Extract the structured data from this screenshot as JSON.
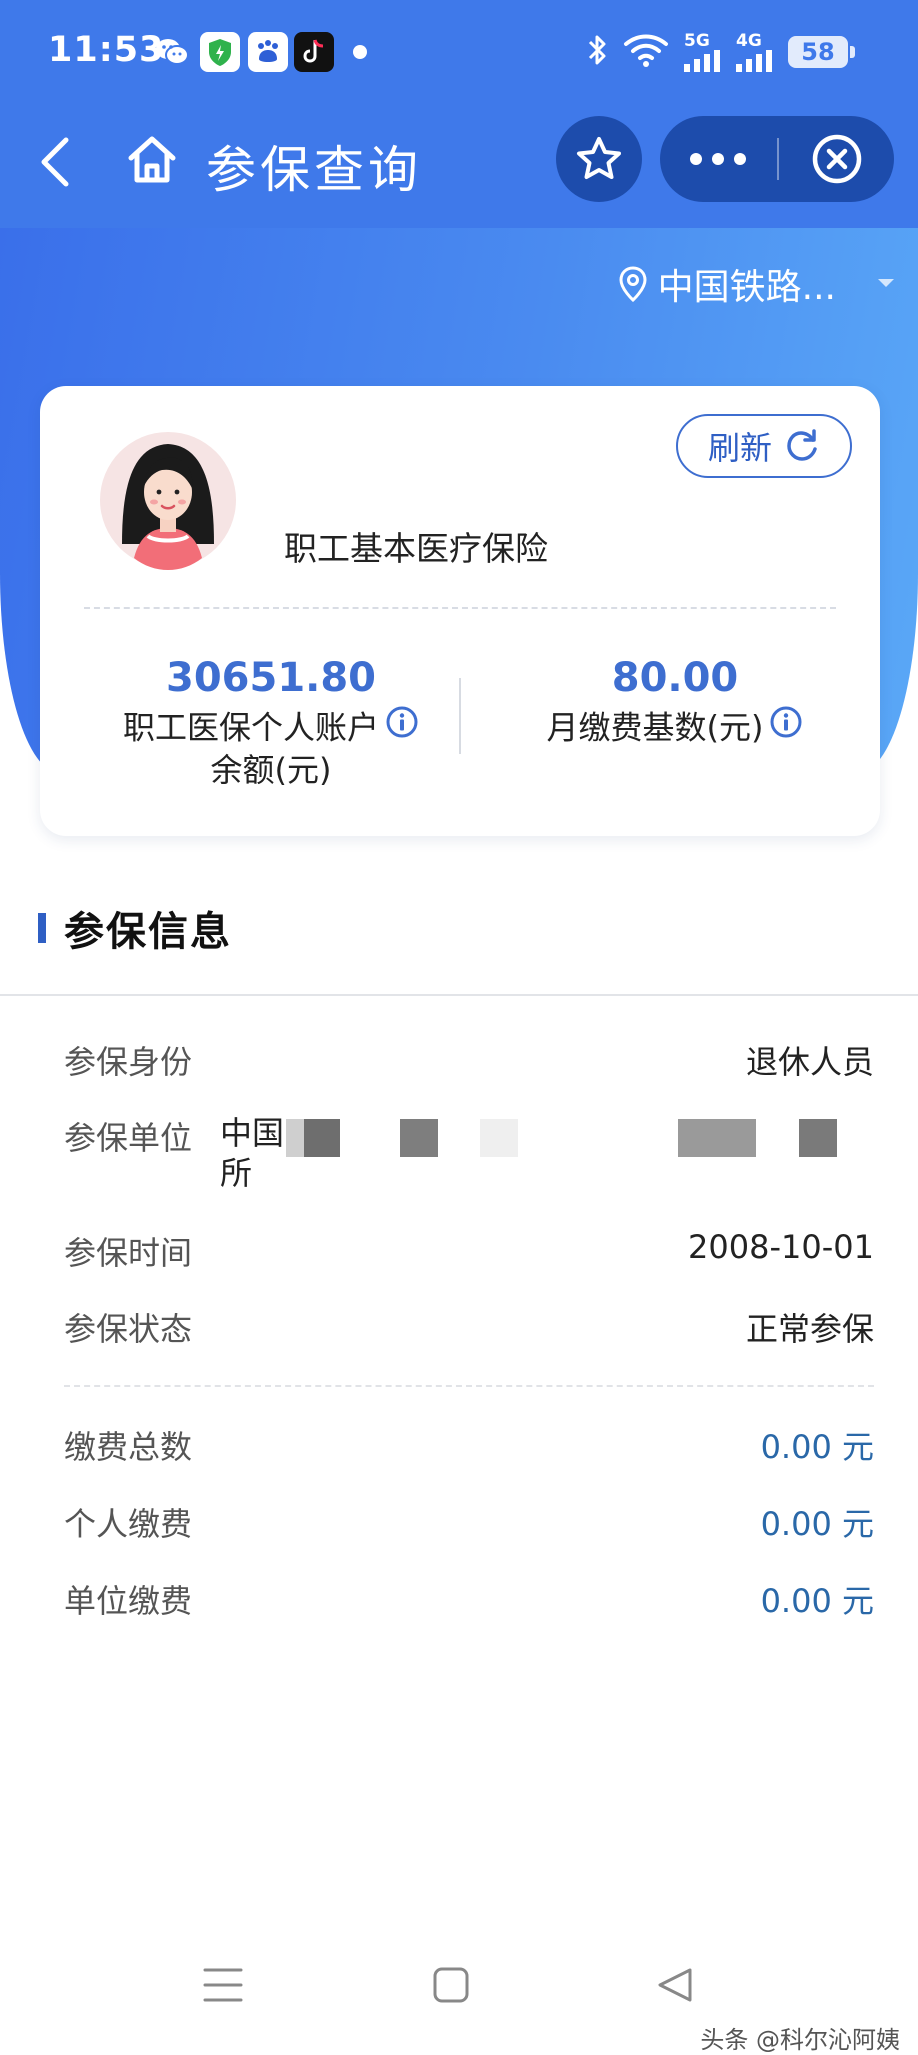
{
  "status_bar": {
    "time": "11:53",
    "network_1": "5G",
    "network_2": "4G",
    "battery": "58"
  },
  "nav": {
    "title": "参保查询"
  },
  "location": {
    "text": "中国铁路..."
  },
  "card": {
    "refresh_label": "刷新",
    "insurance_type": "职工基本医疗保险",
    "balance_value": "30651.80",
    "balance_label_line1": "职工医保个人账户",
    "balance_label_line2": "余额(元)",
    "base_value": "80.00",
    "base_label": "月缴费基数(元)"
  },
  "section": {
    "title": "参保信息"
  },
  "info": {
    "identity_label": "参保身份",
    "identity_value": "退休人员",
    "unit_label": "参保单位",
    "unit_value_line1": "中国",
    "unit_value_line2": "所",
    "time_label": "参保时间",
    "time_value": "2008-10-01",
    "status_label": "参保状态",
    "status_value": "正常参保"
  },
  "payments": {
    "total_label": "缴费总数",
    "total_value": "0.00 元",
    "personal_label": "个人缴费",
    "personal_value": "0.00 元",
    "unit_label": "单位缴费",
    "unit_value": "0.00 元"
  },
  "watermark": {
    "text": "头条 @科尔沁阿姨"
  },
  "colors": {
    "header_blue": "#3f79ea",
    "dark_button": "#1d4cac",
    "accent": "#3e6ed0",
    "money": "#2a68a8"
  }
}
